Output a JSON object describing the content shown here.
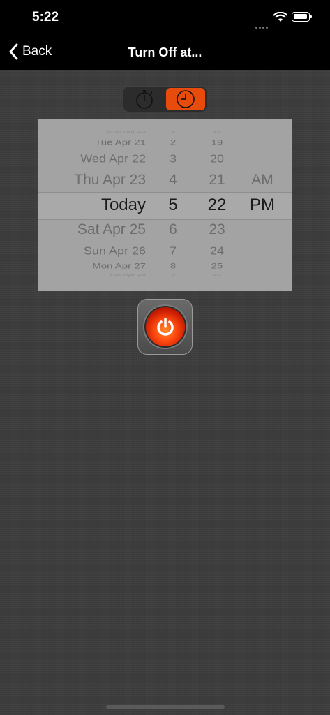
{
  "status": {
    "time": "5:22"
  },
  "nav": {
    "back_label": "Back",
    "title": "Turn Off at..."
  },
  "segments": [
    {
      "icon": "stopwatch-icon",
      "selected": false
    },
    {
      "icon": "clock-icon",
      "selected": true
    }
  ],
  "picker": {
    "dates": [
      "Mon Apr 20",
      "Tue Apr 21",
      "Wed Apr 22",
      "Thu Apr 23",
      "Today",
      "Sat Apr 25",
      "Sun Apr 26",
      "Mon Apr 27",
      "Tue Apr 28"
    ],
    "hours": [
      "1",
      "2",
      "3",
      "4",
      "5",
      "6",
      "7",
      "8",
      "9"
    ],
    "minutes": [
      "18",
      "19",
      "20",
      "21",
      "22",
      "23",
      "24",
      "25",
      "26"
    ],
    "ampm": [
      "AM",
      "PM"
    ],
    "selected": {
      "date": "Today",
      "hour": "5",
      "minute": "22",
      "ampm": "PM"
    }
  },
  "colors": {
    "accent": "#e84c0d",
    "background": "#3d3d3d",
    "power": "#ff4a10"
  }
}
